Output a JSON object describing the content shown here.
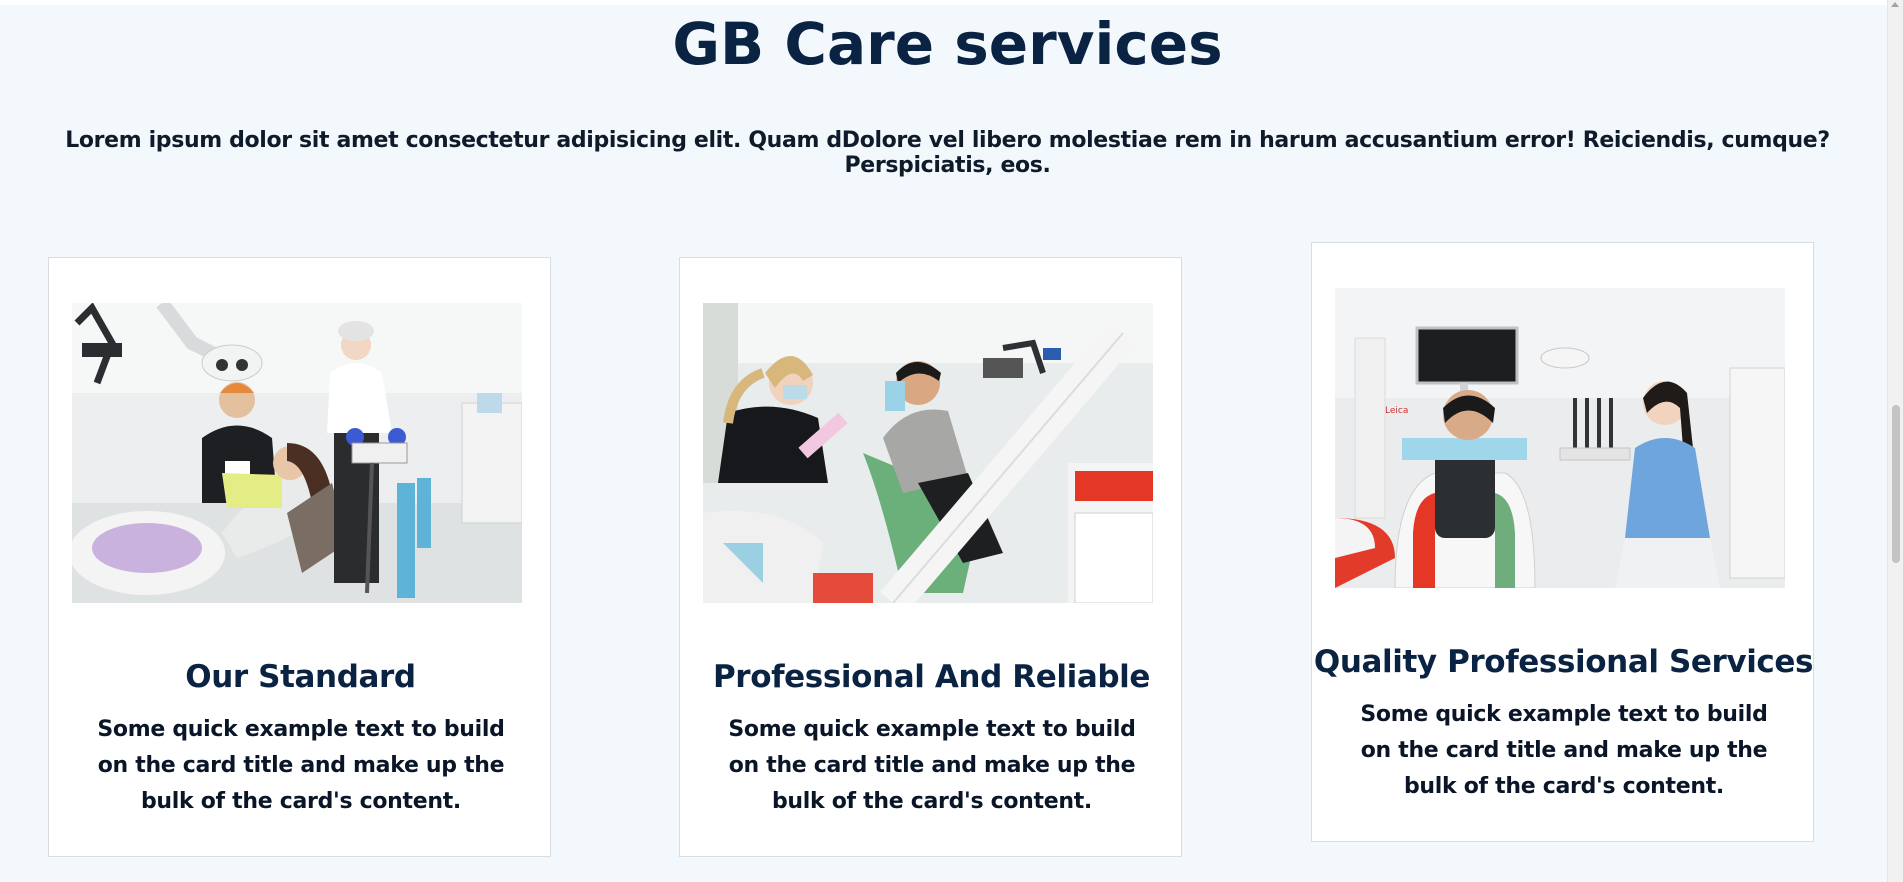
{
  "header": {
    "title": "GB Care services",
    "lead": "Lorem ipsum dolor sit amet consectetur adipisicing elit. Quam dDolore vel libero molestiae rem in harum accusantium error! Reiciendis, cumque? Perspiciatis, eos."
  },
  "cards": [
    {
      "title": "Our Standard",
      "text": "Some quick example text to build on the card title and make up the bulk of the card's content."
    },
    {
      "title": "Professional And Reliable",
      "text": "Some quick example text to build on the card title and make up the bulk of the card's content."
    },
    {
      "title": "Quality Professional Services",
      "text": "Some quick example text to build on the card title and make up the bulk of the card's content."
    }
  ],
  "colors": {
    "background": "#f3f8fd",
    "heading": "#0a2342",
    "card": "#ffffff"
  }
}
